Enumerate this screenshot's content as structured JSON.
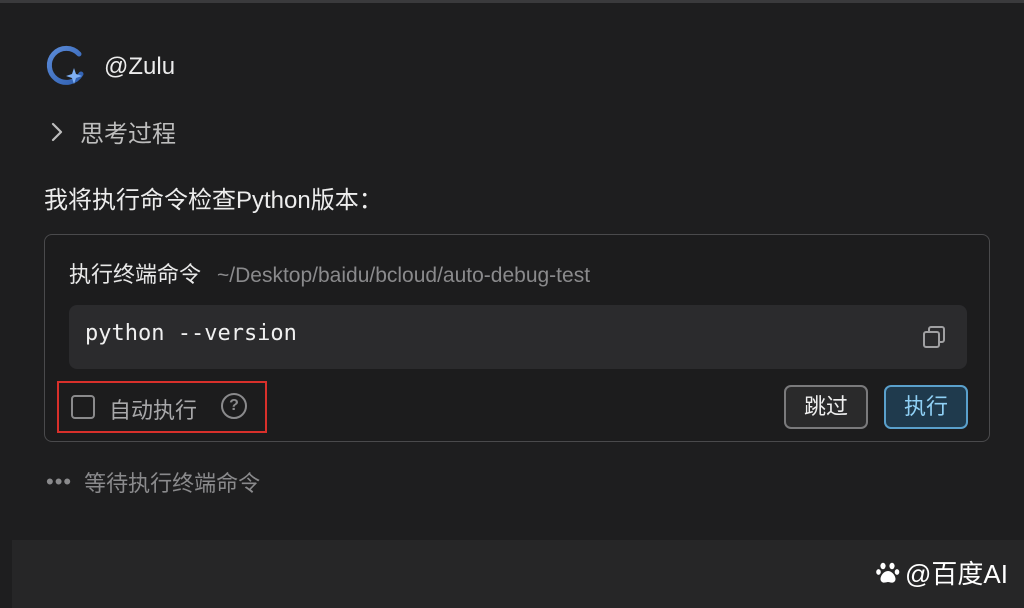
{
  "agent": {
    "name": "@Zulu",
    "avatar_icon": "zulu-logo-icon"
  },
  "thinking": {
    "label": "思考过程",
    "icon": "chevron-right-icon"
  },
  "message": {
    "text": "我将执行命令检查Python版本："
  },
  "command_card": {
    "title": "执行终端命令",
    "path": "~/Desktop/baidu/bcloud/auto-debug-test",
    "command": "python --version",
    "copy_icon": "copy-icon",
    "auto_execute": {
      "label": "自动执行",
      "checked": false,
      "help_icon": "help-circle-icon"
    },
    "buttons": {
      "skip": "跳过",
      "run": "执行"
    }
  },
  "status": {
    "dots": "•••",
    "text": "等待执行终端命令"
  },
  "watermark": {
    "text": "@百度AI",
    "icon": "baidu-paw-icon"
  },
  "colors": {
    "background": "#1e1e1f",
    "card_border": "#4a4a4c",
    "code_bg": "#2b2b2d",
    "highlight_box": "#d9302b",
    "run_button_border": "#5aa0cc",
    "run_button_text": "#8fd0f5"
  }
}
